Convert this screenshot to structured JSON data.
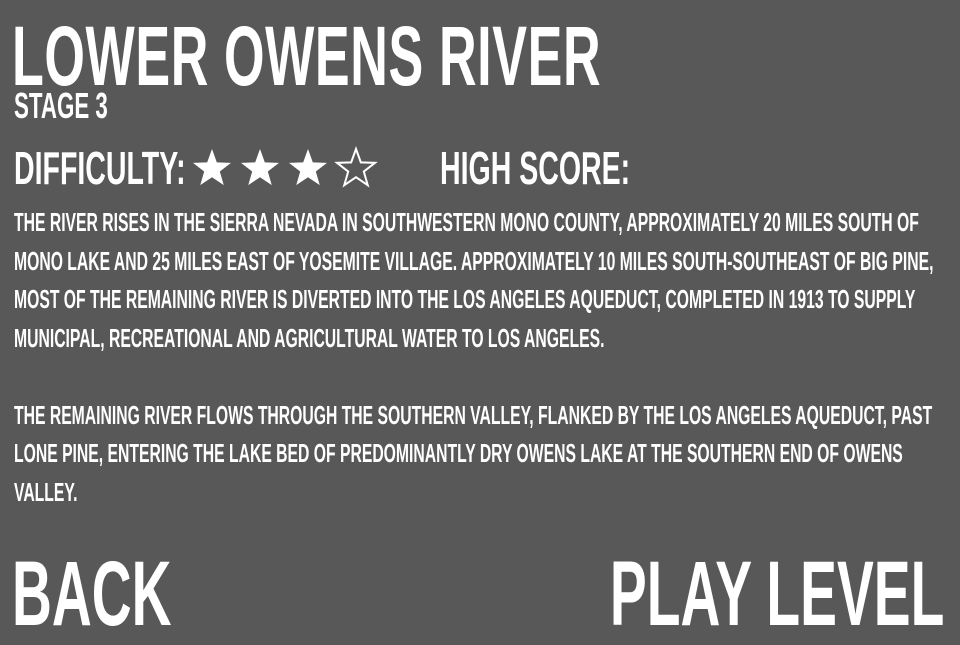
{
  "level": {
    "title": "LOWER OWENS RIVER",
    "stage": "STAGE 3",
    "difficulty_label": "DIFFICULTY:",
    "difficulty": {
      "filled": 3,
      "total": 4
    },
    "high_score_label": "HIGH SCORE:"
  },
  "description": {
    "paragraphs": [
      "THE RIVER RISES IN THE SIERRA NEVADA IN SOUTHWESTERN MONO COUNTY, APPROXIMATELY 20 MILES SOUTH OF MONO LAKE AND 25 MILES EAST OF YOSEMITE VILLAGE. APPROXIMATELY 10 MILES SOUTH-SOUTHEAST OF BIG PINE, MOST OF THE REMAINING RIVER IS DIVERTED INTO THE LOS ANGELES AQUEDUCT, COMPLETED IN 1913 TO SUPPLY MUNICIPAL, RECREATIONAL AND AGRICULTURAL WATER TO LOS ANGELES.",
      "THE REMAINING RIVER FLOWS THROUGH THE SOUTHERN VALLEY, FLANKED BY THE LOS ANGELES AQUEDUCT, PAST LONE PINE, ENTERING THE LAKE BED OF PREDOMINANTLY DRY OWENS LAKE AT THE SOUTHERN END OF OWENS VALLEY."
    ]
  },
  "buttons": {
    "back": "BACK",
    "play": "PLAY LEVEL"
  },
  "colors": {
    "background": "#585858",
    "text": "#ffffff"
  },
  "icons": {
    "star_filled": "star-filled-icon",
    "star_empty": "star-outline-icon"
  }
}
